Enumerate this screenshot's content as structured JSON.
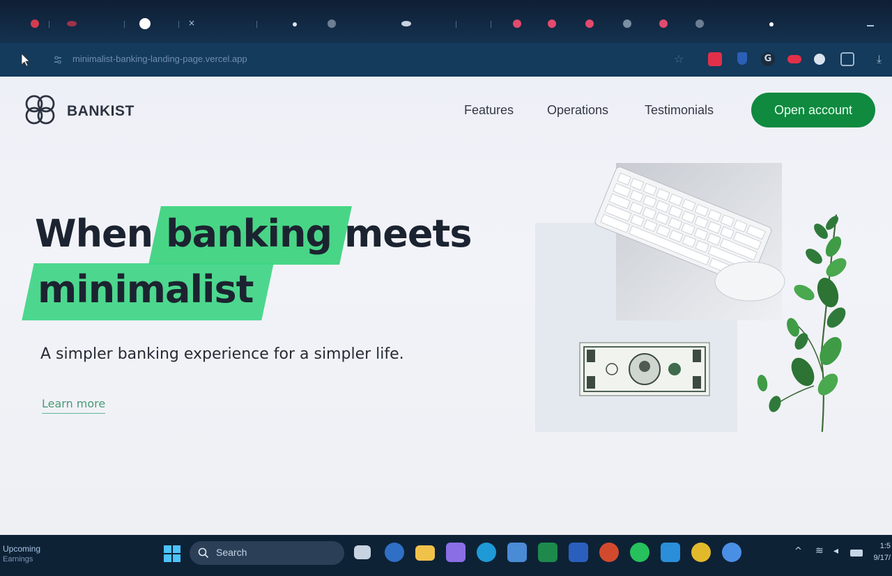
{
  "browser": {
    "url": "minimalist-banking-landing-page.vercel.app",
    "tab_colors": [
      "#d33c4f",
      "#a0324a",
      "#ffffff",
      "#e24b6d",
      "#e24b6d",
      "#e24b6d",
      "#e24b6d"
    ],
    "extension_icons": [
      {
        "name": "bookmark-star-icon",
        "color": "#4a7aa3"
      },
      {
        "name": "extension-red-icon",
        "color": "#e2304a"
      },
      {
        "name": "extension-blue-icon",
        "color": "#2c5fb8"
      },
      {
        "name": "grammarly-icon",
        "color": "#1c2c3c"
      },
      {
        "name": "cloud-icon",
        "color": "#e2304a"
      },
      {
        "name": "extension-white-icon",
        "color": "#d9e3ee"
      },
      {
        "name": "puzzle-icon",
        "color": "#9fb6cc"
      },
      {
        "name": "download-icon",
        "color": "#9fb6cc"
      }
    ]
  },
  "site": {
    "logo_text": "BANKIST",
    "nav": [
      "Features",
      "Operations",
      "Testimonials"
    ],
    "cta": "Open account",
    "accent_color": "#0f8a3f",
    "highlight_color": "#39d37c",
    "hero": {
      "title_word_1": "When",
      "title_highlight_1": "banking",
      "title_word_2": "meets",
      "title_highlight_2": "minimalist",
      "subtitle": "A simpler banking experience for a simpler life.",
      "learn_more": "Learn more"
    }
  },
  "taskbar": {
    "weather_label": "Upcoming",
    "weather_sub": "Earnings",
    "search_placeholder": "Search",
    "time": "1:5",
    "date": "9/17/",
    "apps": [
      {
        "name": "file-explorer-icon",
        "color": "#f1c24a"
      },
      {
        "name": "copilot-icon",
        "color": "#8a6ee6"
      },
      {
        "name": "edge-icon",
        "color": "#1e9ad6"
      },
      {
        "name": "store-icon",
        "color": "#4a8bd6"
      },
      {
        "name": "excel-icon",
        "color": "#1d8a4c"
      },
      {
        "name": "word-icon",
        "color": "#2b5fbd"
      },
      {
        "name": "powerpoint-icon",
        "color": "#d24a2e"
      },
      {
        "name": "whatsapp-icon",
        "color": "#26c15c"
      },
      {
        "name": "vscode-icon",
        "color": "#2a8ed8"
      },
      {
        "name": "chrome-icon",
        "color": "#e3b92c"
      },
      {
        "name": "messenger-icon",
        "color": "#4a8fe6"
      }
    ]
  }
}
